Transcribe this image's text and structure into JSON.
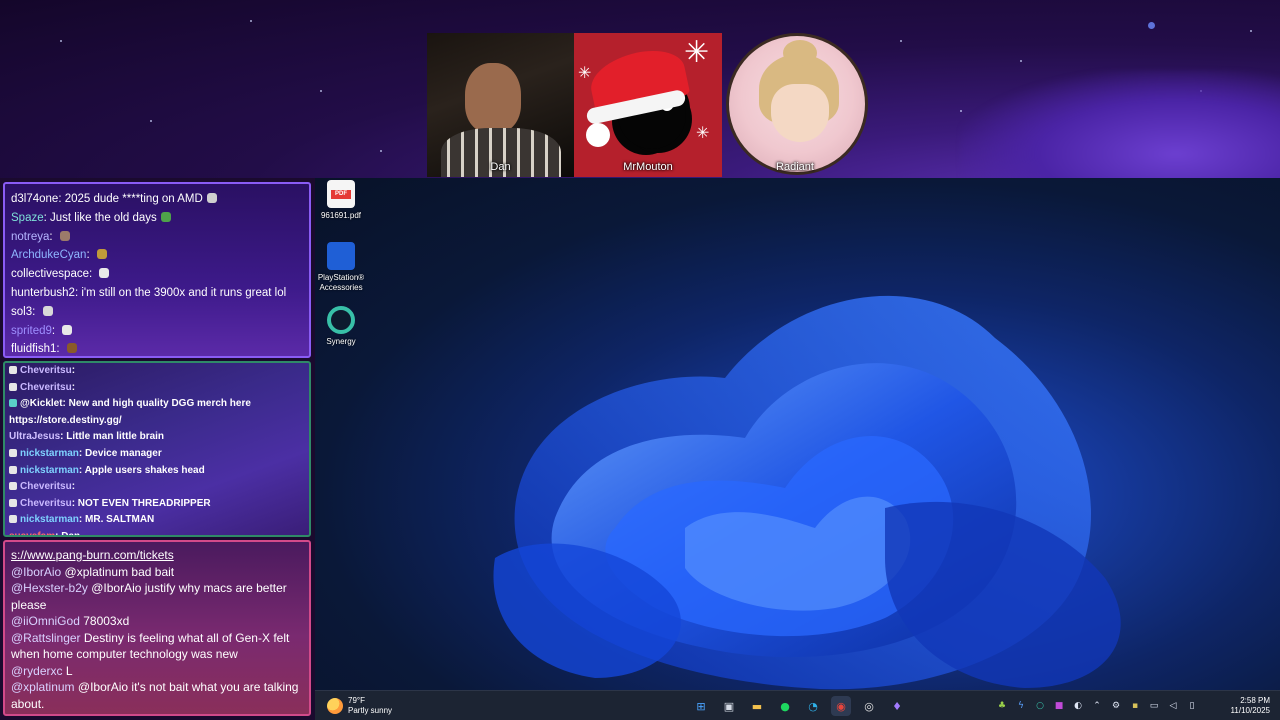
{
  "overlay": {
    "cams": [
      {
        "name": "Dan"
      },
      {
        "name": "MrMouton"
      },
      {
        "name": "Radiant"
      }
    ]
  },
  "chat_top": {
    "messages": [
      {
        "user": "d3l74one",
        "text": "2025 dude ****ting on AMD",
        "user_color": "#ffffff",
        "emote_color": "#cfcfcf"
      },
      {
        "user": "Spaze",
        "text": "Just like the old days",
        "user_color": "#7fe1d8",
        "emote_color": "#4fa34a"
      },
      {
        "user": "notreya",
        "text": "",
        "user_color": "#b6b6ff",
        "emote_color": "#9c7b6a"
      },
      {
        "user": "ArchdukeCyan",
        "text": "",
        "user_color": "#8fb7ff",
        "emote_color": "#c09a3a"
      },
      {
        "user": "collectivespace",
        "text": "",
        "user_color": "#ffffff",
        "emote_color": "#e8e8e8"
      },
      {
        "user": "hunterbush2",
        "text": "i'm still on the 3900x and it runs great lol",
        "user_color": "#ffffff",
        "emote_color": ""
      },
      {
        "user": "sol3",
        "text": "",
        "user_color": "#ffffff",
        "emote_color": "#d8d8d8"
      },
      {
        "user": "sprited9",
        "text": "",
        "user_color": "#9f8fff",
        "emote_color": "#e8e8e8"
      },
      {
        "user": "fluidfish1",
        "text": "",
        "user_color": "#ffffff",
        "emote_color": "#8a5a2a"
      }
    ]
  },
  "chat_mid": {
    "messages": [
      {
        "user": "Cheveritsu",
        "text": "",
        "user_color": "#c9b8ff",
        "badge": "D"
      },
      {
        "user": "Cheveritsu",
        "text": "",
        "user_color": "#c9b8ff",
        "badge": "D"
      },
      {
        "user": "@Kicklet",
        "text": "New and high quality DGG merch here",
        "user_color": "#ffffff",
        "badge": "bot"
      },
      {
        "user": "",
        "text": "https://store.destiny.gg/",
        "user_color": "#ffffff",
        "badge": ""
      },
      {
        "user": "UltraJesus",
        "text": "Little man little brain",
        "user_color": "#d0c0ff",
        "badge": ""
      },
      {
        "user": "nickstarman",
        "text": "Device manager",
        "user_color": "#7fd2ff",
        "badge": "D"
      },
      {
        "user": "nickstarman",
        "text": "Apple users shakes head",
        "user_color": "#7fd2ff",
        "badge": "D"
      },
      {
        "user": "Cheveritsu",
        "text": "",
        "user_color": "#c9b8ff",
        "badge": "D"
      },
      {
        "user": "Cheveritsu",
        "text": "NOT EVEN THREADRIPPER",
        "user_color": "#c9b8ff",
        "badge": "D"
      },
      {
        "user": "nickstarman",
        "text": "MR. SALTMAN",
        "user_color": "#7fd2ff",
        "badge": "D"
      },
      {
        "user": "suavefam",
        "text": "Dan",
        "user_color": "#ff6b6b",
        "badge": ""
      }
    ]
  },
  "chat_bottom": {
    "link": "s://www.pang-burn.com/tickets",
    "messages": [
      {
        "user": "@IborAio",
        "text": "@xplatinum bad bait"
      },
      {
        "user": "@Hexster-b2y",
        "text": "@IborAio justify why macs are better please"
      },
      {
        "user": "@iiOmniGod",
        "text": "78003xd"
      },
      {
        "user": "@Rattslinger",
        "text": "Destiny is feeling what all of Gen-X felt when home computer technology was new"
      },
      {
        "user": "@ryderxc",
        "text": "L"
      },
      {
        "user": "@xplatinum",
        "text": "@IborAio it's not bait what you are talking about."
      }
    ]
  },
  "desktop": {
    "icons": [
      {
        "label": "961691.pdf",
        "icon": "pdf-icon",
        "color": "#e53935"
      },
      {
        "label": "PlayStation® Accessories",
        "icon": "playstation-accessories-icon",
        "color": "#1f5fd6"
      },
      {
        "label": "Synergy",
        "icon": "synergy-icon",
        "color": "#38c0a8"
      }
    ]
  },
  "taskbar": {
    "weather_temp": "79°F",
    "weather_desc": "Partly sunny",
    "apps": [
      {
        "name": "start-icon",
        "glyph": "⊞",
        "color": "#4aa3ff"
      },
      {
        "name": "task-view-icon",
        "glyph": "▣",
        "color": "#d5dbe6"
      },
      {
        "name": "file-explorer-icon",
        "glyph": "▬",
        "color": "#f2c14e"
      },
      {
        "name": "spotify-icon",
        "glyph": "●",
        "color": "#1ed760"
      },
      {
        "name": "edge-icon",
        "glyph": "◔",
        "color": "#2fb0e8"
      },
      {
        "name": "chrome-icon",
        "glyph": "◉",
        "color": "#e8453c"
      },
      {
        "name": "obs-icon",
        "glyph": "◎",
        "color": "#e6e6e6"
      },
      {
        "name": "app-icon",
        "glyph": "♦",
        "color": "#a27bff"
      }
    ],
    "tray": [
      {
        "name": "tray-leaf-icon",
        "glyph": "♣",
        "color": "#9bd14a"
      },
      {
        "name": "tray-bolt-icon",
        "glyph": "ϟ",
        "color": "#5aa0ff"
      },
      {
        "name": "tray-ring-icon",
        "glyph": "○",
        "color": "#38c0a8"
      },
      {
        "name": "tray-app-icon",
        "glyph": "■",
        "color": "#c04ad8"
      },
      {
        "name": "tray-steam-icon",
        "glyph": "◐",
        "color": "#dfe6f5"
      },
      {
        "name": "tray-chevron-icon",
        "glyph": "⌃",
        "color": "#dfe6f5"
      },
      {
        "name": "tray-settings-icon",
        "glyph": "⚙",
        "color": "#dfe6f5"
      },
      {
        "name": "tray-shield-icon",
        "glyph": "▪",
        "color": "#d8c25a"
      },
      {
        "name": "tray-display-icon",
        "glyph": "▭",
        "color": "#dfe6f5"
      },
      {
        "name": "tray-volume-icon",
        "glyph": "◁",
        "color": "#dfe6f5"
      },
      {
        "name": "tray-battery-icon",
        "glyph": "▯",
        "color": "#dfe6f5"
      }
    ],
    "time": "2:58 PM",
    "date": "11/10/2025"
  }
}
